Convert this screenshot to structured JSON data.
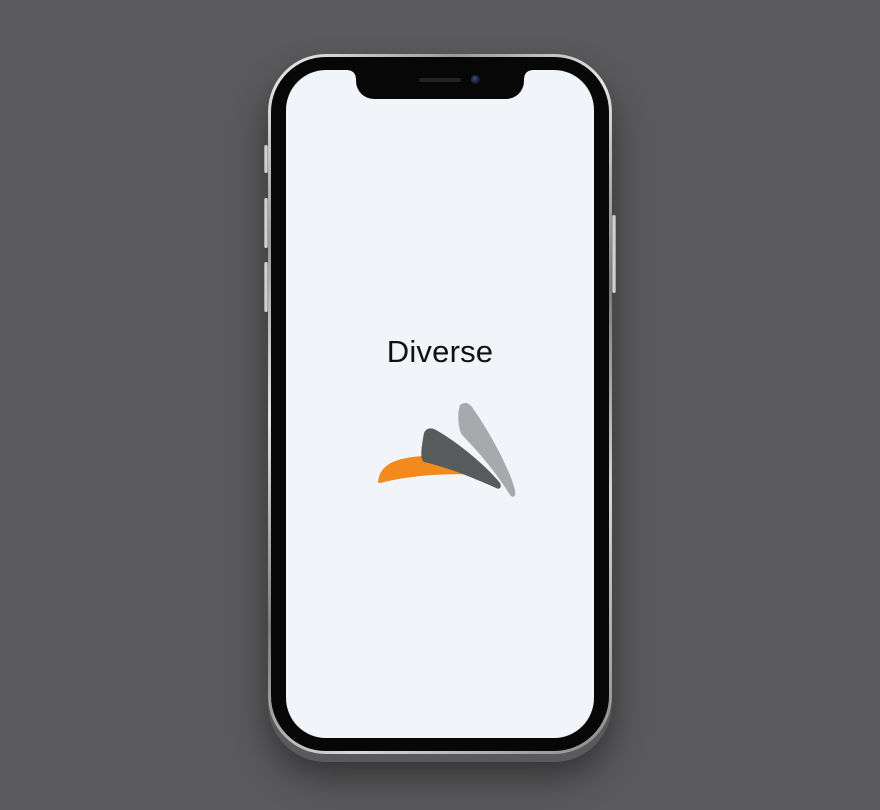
{
  "app": {
    "title": "Diverse"
  },
  "logo": {
    "name": "diverse-logo",
    "colors": {
      "orange": "#f28a1e",
      "dark_gray": "#595a5c",
      "light_gray": "#a7a9ac"
    }
  },
  "device": {
    "screen_background": "#f1f4f8",
    "page_background": "#5a5a5c"
  }
}
